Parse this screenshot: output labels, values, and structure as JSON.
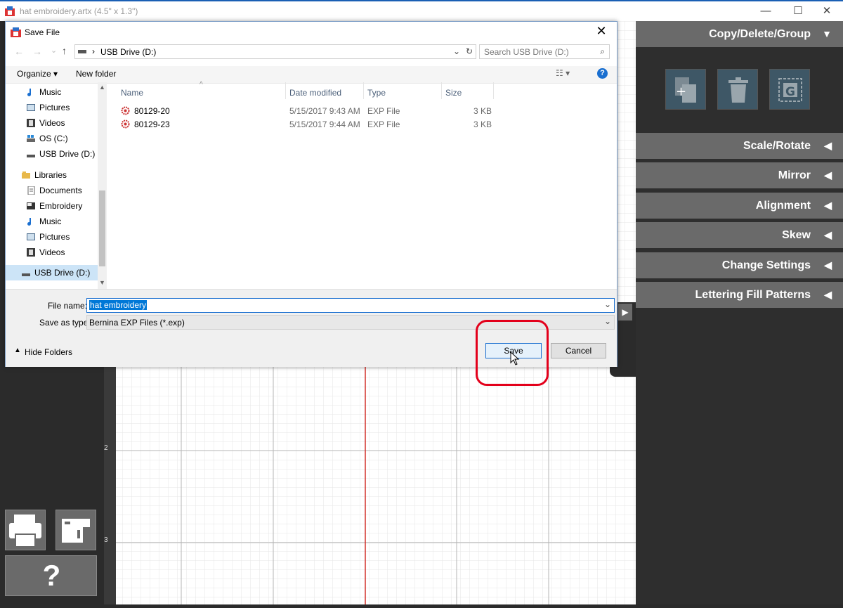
{
  "app": {
    "title": "hat embroidery.artx (4.5\" x 1.3\")",
    "min": "—",
    "max": "☐",
    "close": "✕"
  },
  "ruler": {
    "n2": "2",
    "n3": "3"
  },
  "right_panel": {
    "headers": [
      {
        "label": "Copy/Delete/Group",
        "arrow": "▼"
      },
      {
        "label": "Scale/Rotate",
        "arrow": "◀"
      },
      {
        "label": "Mirror",
        "arrow": "◀"
      },
      {
        "label": "Alignment",
        "arrow": "◀"
      },
      {
        "label": "Skew",
        "arrow": "◀"
      },
      {
        "label": "Change Settings",
        "arrow": "◀"
      },
      {
        "label": "Lettering Fill Patterns",
        "arrow": "◀"
      }
    ],
    "tools": [
      "copy-icon",
      "trash-icon",
      "group-icon"
    ],
    "group_letter": "G"
  },
  "left_buttons": {
    "help": "?"
  },
  "dialog": {
    "title": "Save File",
    "close": "✕",
    "address": {
      "separator": "›",
      "location": "USB Drive (D:)"
    },
    "search_placeholder": "Search USB Drive (D:)",
    "toolbar": {
      "organize": "Organize ▾",
      "new_folder": "New folder"
    },
    "nav": [
      {
        "label": "Music",
        "icon": "music-icon"
      },
      {
        "label": "Pictures",
        "icon": "pictures-icon"
      },
      {
        "label": "Videos",
        "icon": "videos-icon"
      },
      {
        "label": "OS (C:)",
        "icon": "drive-icon"
      },
      {
        "label": "USB Drive (D:)",
        "icon": "usb-drive-icon"
      },
      {
        "label": "Libraries",
        "icon": "libraries-icon"
      },
      {
        "label": "Documents",
        "icon": "documents-icon"
      },
      {
        "label": "Embroidery",
        "icon": "embroidery-icon"
      },
      {
        "label": "Music",
        "icon": "music-icon"
      },
      {
        "label": "Pictures",
        "icon": "pictures-icon"
      },
      {
        "label": "Videos",
        "icon": "videos-icon"
      },
      {
        "label": "USB Drive (D:)",
        "icon": "usb-drive-icon"
      }
    ],
    "columns": {
      "name": "Name",
      "date": "Date modified",
      "type": "Type",
      "size": "Size"
    },
    "files": [
      {
        "name": "80129-20",
        "date": "5/15/2017 9:43 AM",
        "type": "EXP File",
        "size": "3 KB"
      },
      {
        "name": "80129-23",
        "date": "5/15/2017 9:44 AM",
        "type": "EXP File",
        "size": "3 KB"
      }
    ],
    "file_name_label": "File name:",
    "file_name_value": "hat embroidery",
    "save_type_label": "Save as type:",
    "save_type_value": "Bernina EXP Files (*.exp)",
    "hide_folders": "Hide Folders",
    "save": "Save",
    "cancel": "Cancel"
  },
  "colors": {
    "highlight": "#e3001b",
    "accent": "#1a5fb4",
    "panel_header": "#6a6a6a"
  }
}
